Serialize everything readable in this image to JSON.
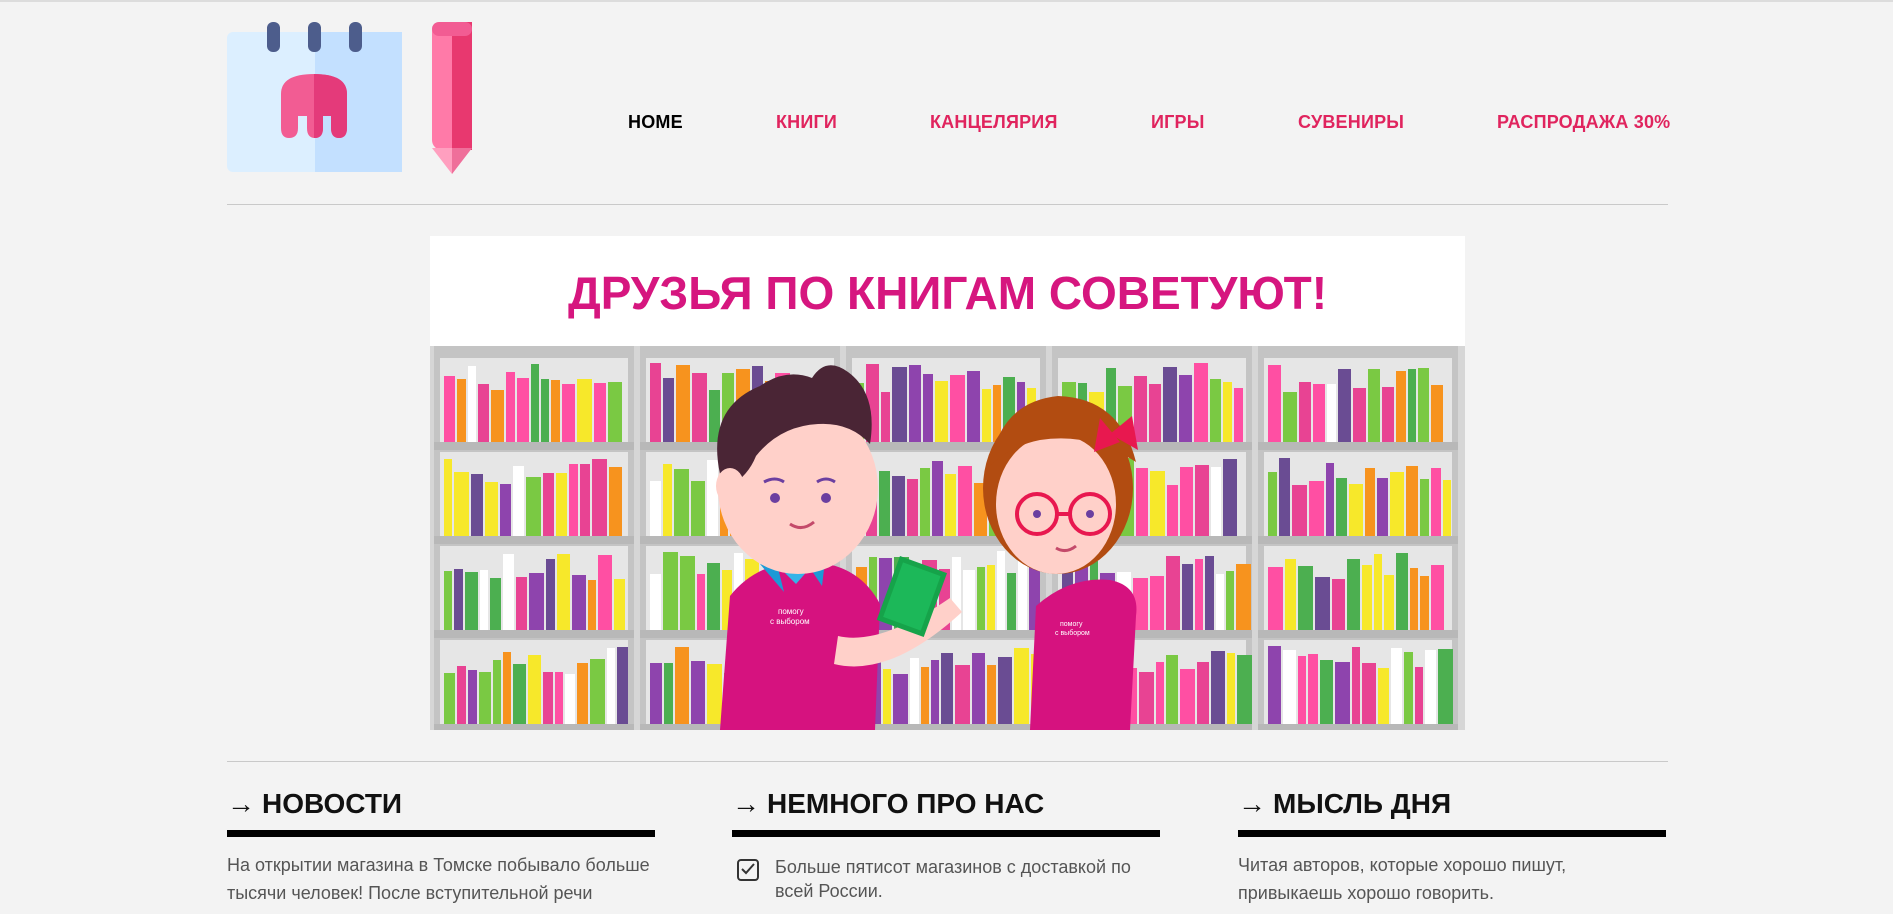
{
  "nav": {
    "items": [
      {
        "label": "HOME",
        "active": true
      },
      {
        "label": "КНИГИ",
        "active": false
      },
      {
        "label": "КАНЦЕЛЯРИЯ",
        "active": false
      },
      {
        "label": "ИГРЫ",
        "active": false
      },
      {
        "label": "СУВЕНИРЫ",
        "active": false
      },
      {
        "label": "РАСПРОДАЖА 30%",
        "active": false
      }
    ]
  },
  "banner": {
    "title": "ДРУЗЬЯ ПО КНИГАМ СОВЕТУЮТ!",
    "shirt_text_line1": "помогу",
    "shirt_text_line2": "с выбором"
  },
  "sections": {
    "news": {
      "arrow": "→",
      "title": "НОВОСТИ",
      "text": "На открытии магазина в Томске побывало больше тысячи человек! После вступительной речи"
    },
    "about": {
      "arrow": "→",
      "title": "НЕМНОГО ПРО НАС",
      "item_text": "Больше пятисот магазинов с доставкой по всей России."
    },
    "thought": {
      "arrow": "→",
      "title": "МЫСЛЬ ДНЯ",
      "text": "Читая авторов, которые хорошо пишут, привыкаешь хорошо говорить."
    }
  },
  "colors": {
    "accent": "#e0245e",
    "banner_title": "#d6167f",
    "background": "#f3f3f3"
  }
}
